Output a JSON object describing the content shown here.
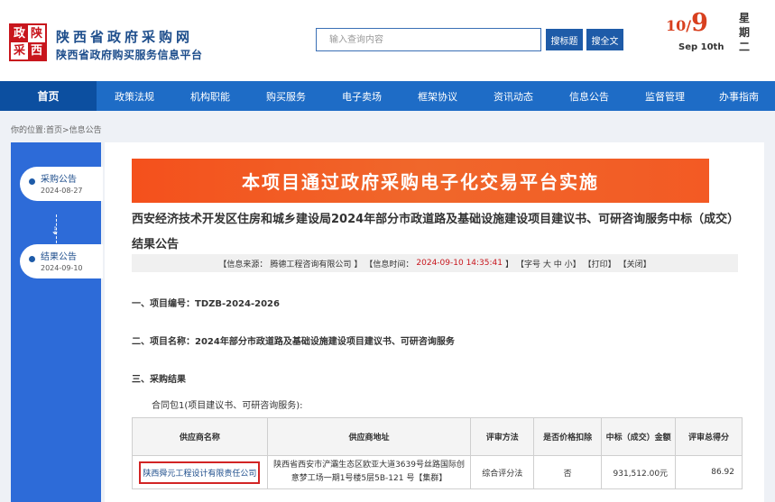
{
  "header": {
    "logo_chars": [
      "政",
      "陕",
      "采",
      "西"
    ],
    "site_title": "陕西省政府采购网",
    "site_subtitle": "陕西省政府购买服务信息平台",
    "search_placeholder": "输入查询内容",
    "btn_search_title": "搜标题",
    "btn_search_full": "搜全文",
    "date_month": "10",
    "date_slash": "/",
    "date_day": "9",
    "date_en": "Sep 10th",
    "weekday": [
      "星",
      "期",
      "二"
    ]
  },
  "nav": {
    "items": [
      "首页",
      "政策法规",
      "机构职能",
      "购买服务",
      "电子卖场",
      "框架协议",
      "资讯动态",
      "信息公告",
      "监督管理",
      "办事指南"
    ]
  },
  "breadcrumb": "你的位置:首页>信息公告",
  "sidebar": {
    "items": [
      {
        "label": "采购公告",
        "date": "2024-08-27"
      },
      {
        "label": "结果公告",
        "date": "2024-09-10"
      }
    ],
    "arrow": "⇣"
  },
  "article": {
    "banner": "本项目通过政府采购电子化交易平台实施",
    "title": "西安经济技术开发区住房和城乡建设局2024年部分市政道路及基础设施建设项目建议书、可研咨询服务中标（成交）结果公告",
    "info": {
      "source_prefix": "【信息来源：",
      "source": "腾德工程咨询有限公司",
      "source_suffix": "】",
      "time_prefix": "【信息时间：",
      "time": "2024-09-10 14:35:41",
      "time_suffix": "】",
      "font_size": "【字号 大 中 小】",
      "print": "【打印】",
      "close": "【关闭】"
    },
    "section1": "一、项目编号：TDZB-2024-2026",
    "section2": "二、项目名称：2024年部分市政道路及基础设施建设项目建议书、可研咨询服务",
    "section3": "三、采购结果",
    "contract": "合同包1(项目建议书、可研咨询服务):",
    "table": {
      "headers": [
        "供应商名称",
        "供应商地址",
        "评审方法",
        "是否价格扣除",
        "中标（成交）金额",
        "评审总得分"
      ],
      "rows": [
        [
          "陕西舜元工程设计有限责任公司",
          "陕西省西安市浐灞生态区欧亚大道3639号丝路国际创意梦工场一期1号楼5层5B-121 号【集群】",
          "综合评分法",
          "否",
          "931,512.00元",
          "86.92"
        ]
      ]
    }
  }
}
